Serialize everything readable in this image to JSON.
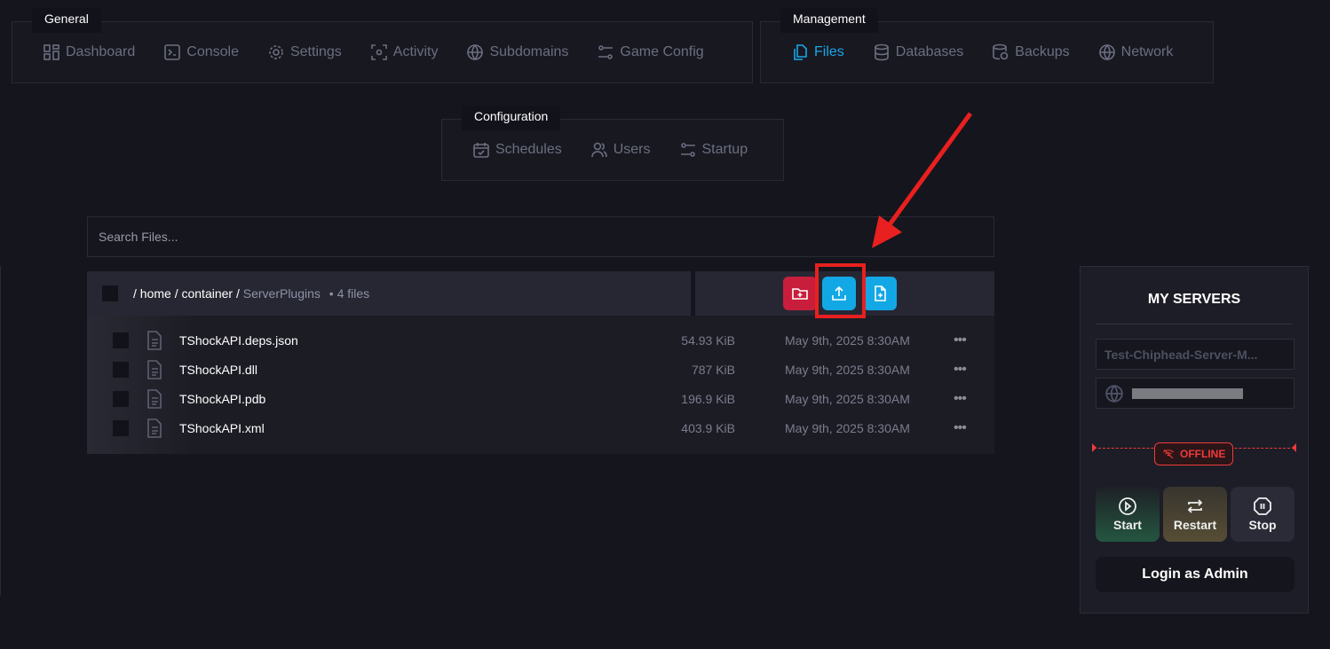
{
  "nav_groups": {
    "general": {
      "title": "General",
      "items": [
        "Dashboard",
        "Console",
        "Settings",
        "Activity",
        "Subdomains",
        "Game Config"
      ]
    },
    "management": {
      "title": "Management",
      "items": [
        "Files",
        "Databases",
        "Backups",
        "Network"
      ],
      "active": "Files"
    },
    "configuration": {
      "title": "Configuration",
      "items": [
        "Schedules",
        "Users",
        "Startup"
      ]
    }
  },
  "search": {
    "placeholder": "Search Files..."
  },
  "breadcrumb": {
    "sep": "/",
    "home": "home",
    "container": "container",
    "current": "ServerPlugins",
    "count": "• 4 files"
  },
  "files": [
    {
      "name": "TShockAPI.deps.json",
      "size": "54.93 KiB",
      "date": "May 9th, 2025 8:30AM"
    },
    {
      "name": "TShockAPI.dll",
      "size": "787 KiB",
      "date": "May 9th, 2025 8:30AM"
    },
    {
      "name": "TShockAPI.pdb",
      "size": "196.9 KiB",
      "date": "May 9th, 2025 8:30AM"
    },
    {
      "name": "TShockAPI.xml",
      "size": "403.9 KiB",
      "date": "May 9th, 2025 8:30AM"
    }
  ],
  "more_glyph": "•••",
  "sidebar": {
    "title": "MY SERVERS",
    "server_name": "Test-Chiphead-Server-M...",
    "status": "OFFLINE",
    "start": "Start",
    "restart": "Restart",
    "stop": "Stop",
    "login": "Login as Admin"
  },
  "colors": {
    "accent": "#1ba7e8",
    "danger": "#c81e3c",
    "annotation": "#e8201f",
    "offline": "#ef3a3a"
  }
}
